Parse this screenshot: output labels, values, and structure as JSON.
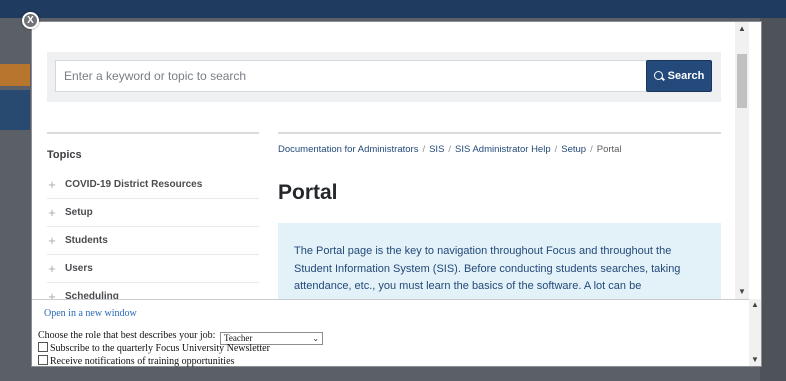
{
  "modal": {
    "close_label": "X"
  },
  "search": {
    "placeholder": "Enter a keyword or topic to search",
    "button_label": "Search"
  },
  "topics": {
    "heading": "Topics",
    "items": [
      {
        "label": "COVID-19 District Resources"
      },
      {
        "label": "Setup"
      },
      {
        "label": "Students"
      },
      {
        "label": "Users"
      },
      {
        "label": "Scheduling"
      }
    ]
  },
  "breadcrumb": {
    "items": [
      "Documentation for Administrators",
      "SIS",
      "SIS Administrator Help",
      "Setup"
    ],
    "current": "Portal"
  },
  "page": {
    "title": "Portal",
    "intro": "The Portal page is the key to navigation throughout Focus and throughout the Student Information System (SIS). Before conducting students searches, taking attendance, etc., you must learn the basics of the software. A lot can be accomplished directly from the"
  },
  "form": {
    "open_new_window": "Open in a new window",
    "role_label": "Choose the role that best describes your job:",
    "role_selected": "Teacher",
    "newsletter_label": "Subscribe to the quarterly Focus University Newsletter",
    "training_label": "Receive notifications of training opportunities"
  },
  "colors": {
    "accent": "#234a7a",
    "info_box": "#e3f1f8",
    "link": "#2a6ab8"
  },
  "icons": [
    "close-icon",
    "search-icon",
    "plus-icon",
    "chevron-down-icon",
    "scroll-up-icon",
    "scroll-down-icon"
  ]
}
